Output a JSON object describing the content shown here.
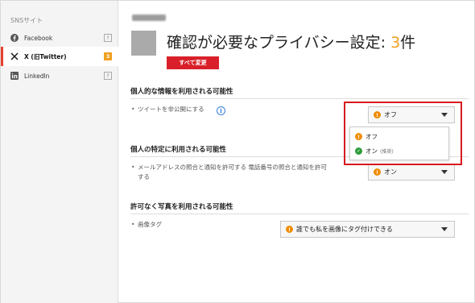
{
  "sidebar": {
    "heading": "SNSサイト",
    "items": [
      {
        "label": "Facebook",
        "badge": "?",
        "icon": "facebook-icon"
      },
      {
        "label": "X (旧Twitter)",
        "badge": "3",
        "icon": "x-logo-icon"
      },
      {
        "label": "LinkedIn",
        "badge": "?",
        "icon": "linkedin-icon"
      }
    ]
  },
  "header": {
    "title_prefix": "確認が必要なプライバシー設定: ",
    "title_count": "3",
    "title_suffix": "件",
    "change_all_label": "すべて変更"
  },
  "sections": [
    {
      "title": "個人的な情報を利用される可能性",
      "setting": "ツイートを非公開にする",
      "selected": "オフ",
      "selected_status": "warning"
    },
    {
      "title": "個人の特定に利用される可能性",
      "setting_line1": "メールアドレスの照合と通知を許可する 電話番号の照合と通知を許可",
      "setting_line2": "する",
      "selected": "オン",
      "selected_status": "warning"
    },
    {
      "title": "許可なく写真を利用される可能性",
      "setting": "画像タグ",
      "selected": "誰でも私を画像にタグ付けできる",
      "selected_status": "warning"
    }
  ],
  "dropdown": {
    "options": [
      {
        "label": "オフ",
        "status": "warning"
      },
      {
        "label": "オン",
        "note": "(推奨)",
        "status": "ok"
      }
    ]
  },
  "colors": {
    "accent_red": "#d9202a",
    "warning_orange": "#f08c00",
    "ok_green": "#2e9c3a",
    "count_orange": "#f0a020",
    "highlight_red": "#d7191f"
  }
}
